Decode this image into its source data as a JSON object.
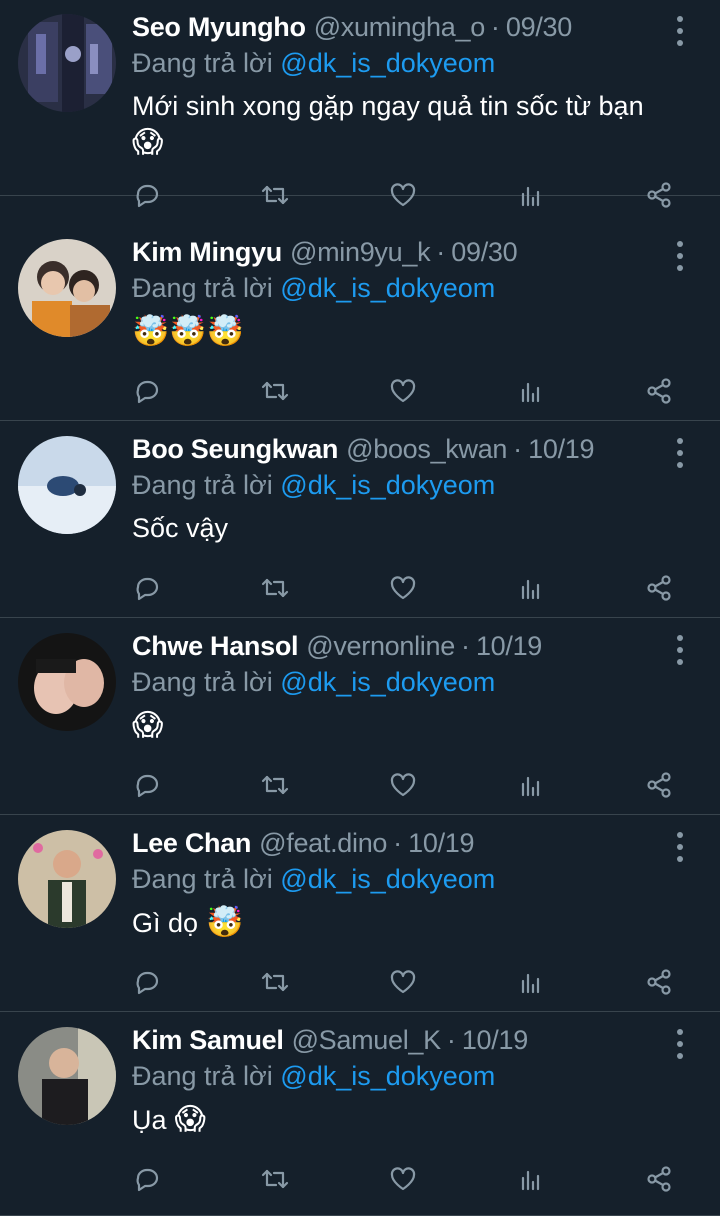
{
  "reply_prefix": "Đang trả lời",
  "colors": {
    "background": "#15202b",
    "muted": "#8899a6",
    "mention": "#1d9bf0",
    "divider": "#38444d"
  },
  "icons": [
    "more-icon",
    "reply-icon",
    "retweet-icon",
    "like-icon",
    "analytics-icon",
    "share-icon"
  ],
  "tweets": [
    {
      "name": "Seo Myungho",
      "handle": "@xumingha_o",
      "date": "09/30",
      "reply_to": "@dk_is_dokyeom",
      "text": "Mới sinh xong gặp ngay quả tin sốc từ bạn",
      "emoji": "😱"
    },
    {
      "name": "Kim Mingyu",
      "handle": "@min9yu_k",
      "date": "09/30",
      "reply_to": "@dk_is_dokyeom",
      "text": "",
      "emoji": "🤯🤯🤯"
    },
    {
      "name": "Boo Seungkwan",
      "handle": "@boos_kwan",
      "date": "10/19",
      "reply_to": "@dk_is_dokyeom",
      "text": "Sốc vậy",
      "emoji": ""
    },
    {
      "name": "Chwe Hansol",
      "handle": "@vernonline",
      "date": "10/19",
      "reply_to": "@dk_is_dokyeom",
      "text": "",
      "emoji": "😱"
    },
    {
      "name": "Lee Chan",
      "handle": "@feat.dino",
      "date": "10/19",
      "reply_to": "@dk_is_dokyeom",
      "text": "Gì dọ",
      "emoji": "🤯"
    },
    {
      "name": "Kim Samuel",
      "handle": "@Samuel_K",
      "date": "10/19",
      "reply_to": "@dk_is_dokyeom",
      "text": "Ụa",
      "emoji": "😱"
    }
  ]
}
